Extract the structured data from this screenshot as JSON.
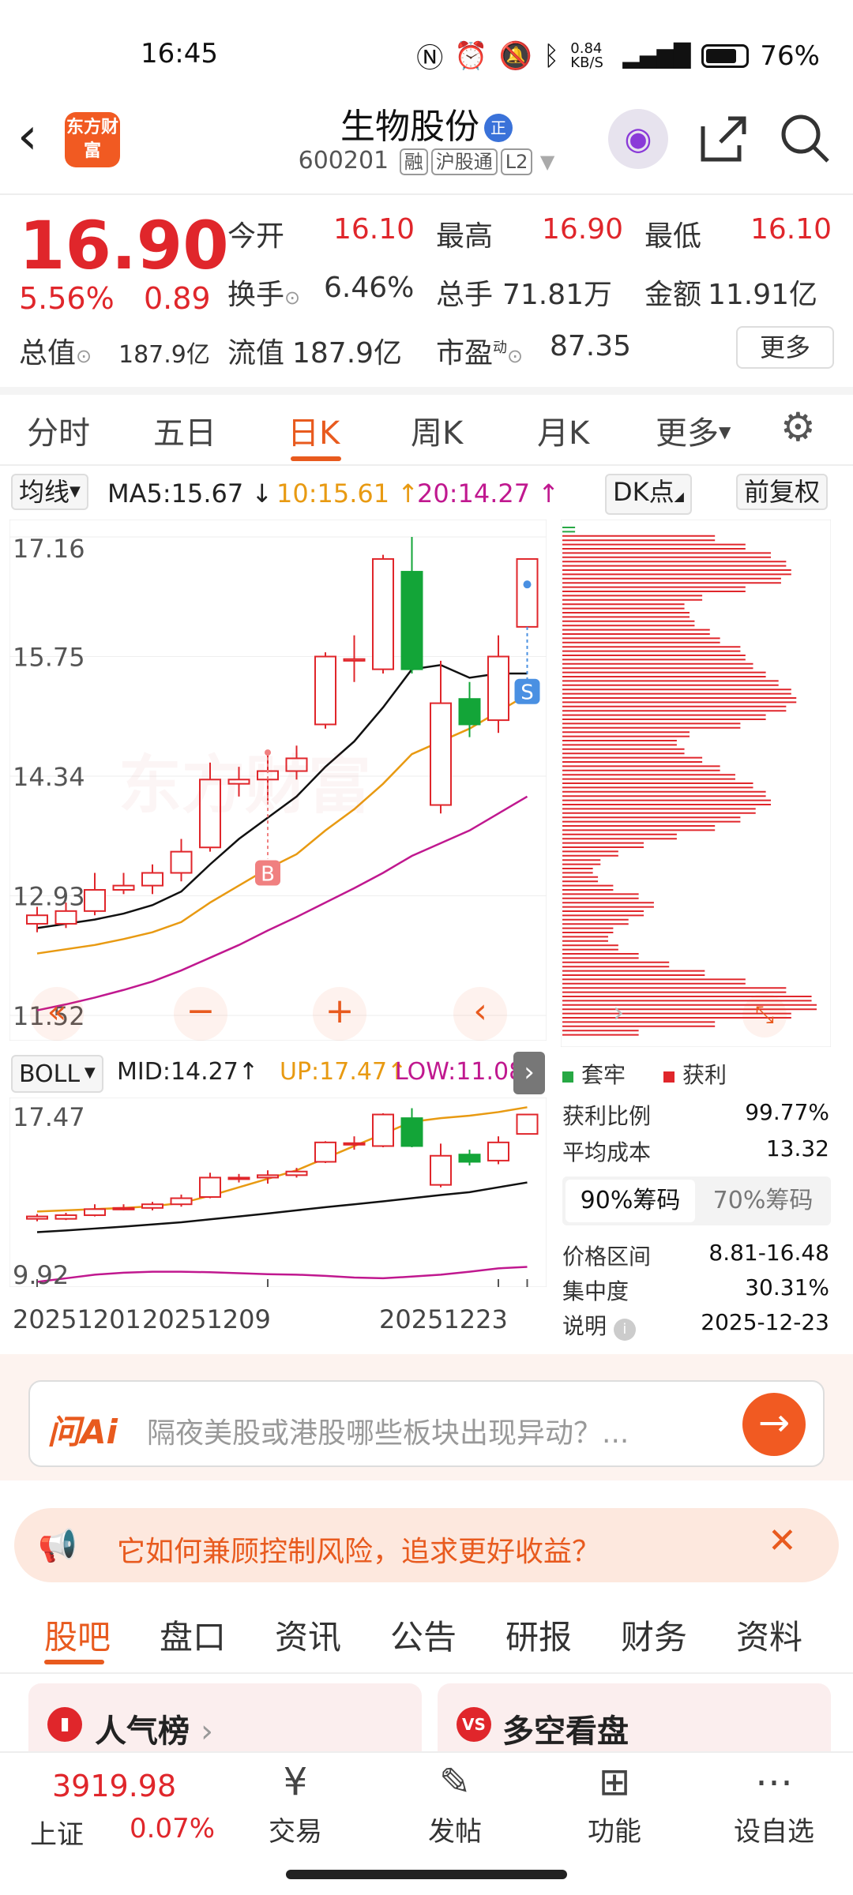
{
  "status_bar": {
    "time": "16:45",
    "net_speed": "0.84 KB/S",
    "battery": "76%"
  },
  "header": {
    "logo_text": "东方财富",
    "stock_name": "生物股份",
    "badge": "正",
    "code": "600201",
    "tags": [
      "融",
      "沪股通",
      "L2"
    ]
  },
  "quote": {
    "price": "16.90",
    "pct": "5.56%",
    "change": "0.89",
    "open_label": "今开",
    "open": "16.10",
    "high_label": "最高",
    "high": "16.90",
    "low_label": "最低",
    "low": "16.10",
    "turnover_label": "换手",
    "turnover": "6.46%",
    "volume_label": "总手",
    "volume": "71.81万",
    "amount_label": "金额",
    "amount": "11.91亿",
    "mktcap_label": "总值",
    "mktcap": "187.9亿",
    "float_label": "流值",
    "float": "187.9亿",
    "pe_label": "市盈",
    "pe_sup": "动",
    "pe": "87.35",
    "more": "更多"
  },
  "tabs": [
    "分时",
    "五日",
    "日K",
    "周K",
    "月K",
    "更多"
  ],
  "ma": {
    "label": "均线",
    "ma5": "MA5:15.67",
    "ma10": "10:15.61",
    "ma20": "20:14.27",
    "dk": "DK点",
    "adjust": "前复权"
  },
  "main_axis": [
    "17.16",
    "15.75",
    "14.34",
    "12.93",
    "11.52"
  ],
  "markers": {
    "buy": "B",
    "sell": "S"
  },
  "watermark": "东方财富",
  "boll": {
    "label": "BOLL",
    "mid": "MID:14.27",
    "up": "UP:17.47",
    "low": "LOW:11.08",
    "axis_top": "17.47",
    "axis_bottom": "9.92"
  },
  "dates": [
    "20251201",
    "20251209",
    "20251223"
  ],
  "chips": {
    "legend_trap": "套牢",
    "legend_profit": "获利",
    "rows": [
      {
        "label": "获利比例",
        "value": "99.77%"
      },
      {
        "label": "平均成本",
        "value": "13.32"
      }
    ],
    "tab_active": "90%筹码",
    "tab_other": "70%筹码",
    "rows2": [
      {
        "label": "价格区间",
        "value": "8.81-16.48"
      },
      {
        "label": "集中度",
        "value": "30.31%"
      },
      {
        "label": "说明",
        "value": "2025-12-23"
      }
    ]
  },
  "ai": {
    "logo": "问Ai",
    "placeholder": "隔夜美股或港股哪些板块出现异动？..."
  },
  "banner": {
    "text": "它如何兼顾控制风险，追求更好收益？"
  },
  "bottom_tabs": [
    "股吧",
    "盘口",
    "资讯",
    "公告",
    "研报",
    "财务",
    "资料"
  ],
  "cards": [
    "人气榜",
    "多空看盘"
  ],
  "nav": {
    "index_value": "3919.98",
    "index_name": "上证",
    "index_pct": "0.07%",
    "items": [
      "交易",
      "发帖",
      "功能",
      "设自选"
    ]
  },
  "chart_data": {
    "type": "candlestick",
    "ylim": [
      11.52,
      17.16
    ],
    "candles": [
      {
        "o": 12.6,
        "c": 12.7,
        "h": 12.8,
        "l": 12.5
      },
      {
        "o": 12.6,
        "c": 12.75,
        "h": 12.85,
        "l": 12.55
      },
      {
        "o": 12.75,
        "c": 13.0,
        "h": 13.2,
        "l": 12.7
      },
      {
        "o": 13.0,
        "c": 13.05,
        "h": 13.2,
        "l": 12.95
      },
      {
        "o": 13.05,
        "c": 13.2,
        "h": 13.3,
        "l": 12.95
      },
      {
        "o": 13.2,
        "c": 13.45,
        "h": 13.6,
        "l": 13.1
      },
      {
        "o": 13.5,
        "c": 14.3,
        "h": 14.5,
        "l": 13.45
      },
      {
        "o": 14.25,
        "c": 14.3,
        "h": 14.45,
        "l": 14.1
      },
      {
        "o": 14.3,
        "c": 14.4,
        "h": 14.6,
        "l": 14.05
      },
      {
        "o": 14.4,
        "c": 14.55,
        "h": 14.7,
        "l": 14.3
      },
      {
        "o": 14.95,
        "c": 15.75,
        "h": 15.8,
        "l": 14.9
      },
      {
        "o": 15.7,
        "c": 15.72,
        "h": 16.0,
        "l": 15.45
      },
      {
        "o": 15.6,
        "c": 16.9,
        "h": 16.95,
        "l": 15.55
      },
      {
        "o": 16.75,
        "c": 15.6,
        "h": 17.16,
        "l": 15.55
      },
      {
        "o": 14.0,
        "c": 15.2,
        "h": 15.7,
        "l": 13.9
      },
      {
        "o": 15.25,
        "c": 14.95,
        "h": 15.45,
        "l": 14.8
      },
      {
        "o": 15.0,
        "c": 15.75,
        "h": 16.0,
        "l": 14.85
      },
      {
        "o": 16.1,
        "c": 16.9,
        "h": 16.9,
        "l": 16.1
      }
    ],
    "ma5": [
      12.55,
      12.6,
      12.65,
      12.72,
      12.82,
      12.98,
      13.3,
      13.6,
      13.85,
      14.1,
      14.45,
      14.75,
      15.15,
      15.6,
      15.65,
      15.5,
      15.55,
      15.55
    ],
    "ma10": [
      12.25,
      12.3,
      12.35,
      12.42,
      12.5,
      12.62,
      12.85,
      13.05,
      13.25,
      13.42,
      13.7,
      13.95,
      14.25,
      14.6,
      14.75,
      14.9,
      15.1,
      15.3
    ],
    "ma20": [
      11.58,
      11.65,
      11.73,
      11.82,
      11.92,
      12.05,
      12.2,
      12.35,
      12.52,
      12.68,
      12.85,
      13.02,
      13.2,
      13.4,
      13.55,
      13.7,
      13.9,
      14.1
    ],
    "boll_ylim": [
      9.92,
      17.47
    ],
    "boll_up": [
      12.9,
      12.95,
      13.0,
      13.05,
      13.12,
      13.25,
      13.55,
      13.9,
      14.25,
      14.6,
      15.1,
      15.6,
      16.1,
      16.6,
      16.75,
      16.85,
      17.0,
      17.2
    ],
    "boll_mid": [
      12.05,
      12.12,
      12.2,
      12.28,
      12.37,
      12.46,
      12.58,
      12.7,
      12.82,
      12.95,
      13.08,
      13.2,
      13.32,
      13.45,
      13.58,
      13.7,
      13.9,
      14.1
    ],
    "boll_low": [
      10.0,
      10.15,
      10.3,
      10.38,
      10.42,
      10.42,
      10.4,
      10.36,
      10.32,
      10.3,
      10.25,
      10.18,
      10.15,
      10.22,
      10.3,
      10.42,
      10.56,
      10.62
    ],
    "chip_profile": [
      0.05,
      0.6,
      0.72,
      0.82,
      0.88,
      0.9,
      0.86,
      0.72,
      0.55,
      0.48,
      0.5,
      0.52,
      0.58,
      0.62,
      0.7,
      0.72,
      0.75,
      0.8,
      0.85,
      0.9,
      0.92,
      0.88,
      0.8,
      0.7,
      0.5,
      0.45,
      0.48,
      0.55,
      0.62,
      0.68,
      0.75,
      0.8,
      0.82,
      0.76,
      0.7,
      0.6,
      0.45,
      0.32,
      0.22,
      0.15,
      0.12,
      0.14,
      0.2,
      0.3,
      0.36,
      0.32,
      0.26,
      0.2,
      0.18,
      0.22,
      0.3,
      0.42,
      0.56,
      0.72,
      0.88,
      0.98,
      1.0,
      0.9,
      0.6,
      0.3
    ]
  }
}
